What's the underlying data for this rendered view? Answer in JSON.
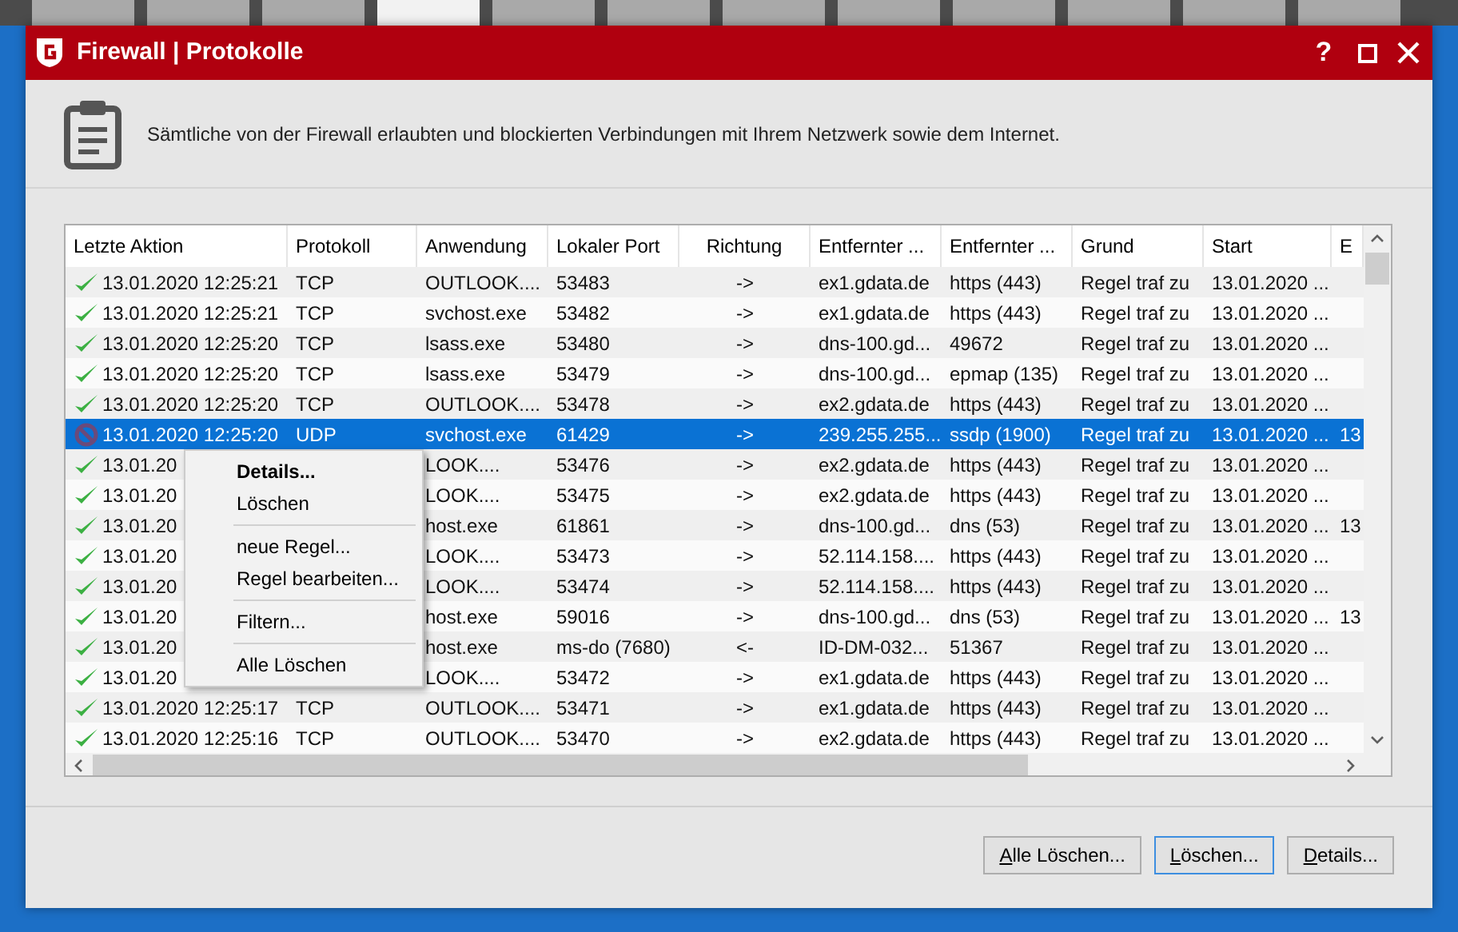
{
  "toolbar": {
    "tiles": [
      {
        "selected": false
      },
      {
        "selected": false
      },
      {
        "selected": false
      },
      {
        "selected": true
      },
      {
        "selected": false
      },
      {
        "selected": false
      },
      {
        "selected": false
      },
      {
        "selected": false
      },
      {
        "selected": false
      },
      {
        "selected": false
      },
      {
        "selected": false
      },
      {
        "selected": false
      }
    ]
  },
  "window": {
    "title": "Firewall | Protokolle",
    "controls": [
      "?"
    ]
  },
  "description": "Sämtliche von der Firewall erlaubten und blockierten Verbindungen mit Ihrem Netzwerk sowie dem Internet.",
  "table": {
    "columns": [
      "Letzte Aktion",
      "Protokoll",
      "Anwendung",
      "Lokaler Port",
      "Richtung",
      "Entfernter ...",
      "Entfernter ...",
      "Grund",
      "Start",
      "E"
    ],
    "rows": [
      {
        "kind": "allowed",
        "selected": false,
        "cells": [
          "13.01.2020 12:25:21",
          "TCP",
          "OUTLOOK....",
          "53483",
          "->",
          "ex1.gdata.de",
          "https (443)",
          "Regel traf zu",
          "13.01.2020 ...",
          ""
        ]
      },
      {
        "kind": "allowed",
        "selected": false,
        "cells": [
          "13.01.2020 12:25:21",
          "TCP",
          "svchost.exe",
          "53482",
          "->",
          "ex1.gdata.de",
          "https (443)",
          "Regel traf zu",
          "13.01.2020 ...",
          ""
        ]
      },
      {
        "kind": "allowed",
        "selected": false,
        "cells": [
          "13.01.2020 12:25:20",
          "TCP",
          "lsass.exe",
          "53480",
          "->",
          "dns-100.gd...",
          "49672",
          "Regel traf zu",
          "13.01.2020 ...",
          ""
        ]
      },
      {
        "kind": "allowed",
        "selected": false,
        "cells": [
          "13.01.2020 12:25:20",
          "TCP",
          "lsass.exe",
          "53479",
          "->",
          "dns-100.gd...",
          "epmap (135)",
          "Regel traf zu",
          "13.01.2020 ...",
          ""
        ]
      },
      {
        "kind": "allowed",
        "selected": false,
        "cells": [
          "13.01.2020 12:25:20",
          "TCP",
          "OUTLOOK....",
          "53478",
          "->",
          "ex2.gdata.de",
          "https (443)",
          "Regel traf zu",
          "13.01.2020 ...",
          ""
        ]
      },
      {
        "kind": "blocked",
        "selected": true,
        "cells": [
          "13.01.2020 12:25:20",
          "UDP",
          "svchost.exe",
          "61429",
          "->",
          "239.255.255...",
          "ssdp (1900)",
          "Regel traf zu",
          "13.01.2020 ...",
          "13"
        ]
      },
      {
        "kind": "allowed",
        "selected": false,
        "cells": [
          "13.01.20",
          "",
          "LOOK....",
          "53476",
          "->",
          "ex2.gdata.de",
          "https (443)",
          "Regel traf zu",
          "13.01.2020 ...",
          ""
        ]
      },
      {
        "kind": "allowed",
        "selected": false,
        "cells": [
          "13.01.20",
          "",
          "LOOK....",
          "53475",
          "->",
          "ex2.gdata.de",
          "https (443)",
          "Regel traf zu",
          "13.01.2020 ...",
          ""
        ]
      },
      {
        "kind": "allowed",
        "selected": false,
        "cells": [
          "13.01.20",
          "",
          "host.exe",
          "61861",
          "->",
          "dns-100.gd...",
          "dns (53)",
          "Regel traf zu",
          "13.01.2020 ...",
          "13"
        ]
      },
      {
        "kind": "allowed",
        "selected": false,
        "cells": [
          "13.01.20",
          "",
          "LOOK....",
          "53473",
          "->",
          "52.114.158....",
          "https (443)",
          "Regel traf zu",
          "13.01.2020 ...",
          ""
        ]
      },
      {
        "kind": "allowed",
        "selected": false,
        "cells": [
          "13.01.20",
          "",
          "LOOK....",
          "53474",
          "->",
          "52.114.158....",
          "https (443)",
          "Regel traf zu",
          "13.01.2020 ...",
          ""
        ]
      },
      {
        "kind": "allowed",
        "selected": false,
        "cells": [
          "13.01.20",
          "",
          "host.exe",
          "59016",
          "->",
          "dns-100.gd...",
          "dns (53)",
          "Regel traf zu",
          "13.01.2020 ...",
          "13"
        ]
      },
      {
        "kind": "allowed",
        "selected": false,
        "cells": [
          "13.01.20",
          "",
          "host.exe",
          "ms-do (7680)",
          "<-",
          "ID-DM-032...",
          "51367",
          "Regel traf zu",
          "13.01.2020 ...",
          ""
        ]
      },
      {
        "kind": "allowed",
        "selected": false,
        "cells": [
          "13.01.20",
          "",
          "LOOK....",
          "53472",
          "->",
          "ex1.gdata.de",
          "https (443)",
          "Regel traf zu",
          "13.01.2020 ...",
          ""
        ]
      },
      {
        "kind": "allowed",
        "selected": false,
        "cells": [
          "13.01.2020 12:25:17",
          "TCP",
          "OUTLOOK....",
          "53471",
          "->",
          "ex1.gdata.de",
          "https (443)",
          "Regel traf zu",
          "13.01.2020 ...",
          ""
        ]
      },
      {
        "kind": "allowed",
        "selected": false,
        "cells": [
          "13.01.2020 12:25:16",
          "TCP",
          "OUTLOOK....",
          "53470",
          "->",
          "ex2.gdata.de",
          "https (443)",
          "Regel traf zu",
          "13.01.2020 ...",
          ""
        ]
      }
    ]
  },
  "context_menu": {
    "items": [
      {
        "kind": "item",
        "label": "Details...",
        "default": true
      },
      {
        "kind": "item",
        "label": "Löschen",
        "default": false
      },
      {
        "kind": "separator"
      },
      {
        "kind": "item",
        "label": "neue Regel...",
        "default": false
      },
      {
        "kind": "item",
        "label": "Regel bearbeiten...",
        "default": false
      },
      {
        "kind": "separator"
      },
      {
        "kind": "item",
        "label": "Filtern...",
        "default": false
      },
      {
        "kind": "separator"
      },
      {
        "kind": "item",
        "label": "Alle Löschen",
        "default": false
      }
    ]
  },
  "buttons": [
    {
      "label": "Alle Löschen...",
      "focused": false
    },
    {
      "label": "Löschen...",
      "focused": true
    },
    {
      "label": "Details...",
      "focused": false
    }
  ]
}
